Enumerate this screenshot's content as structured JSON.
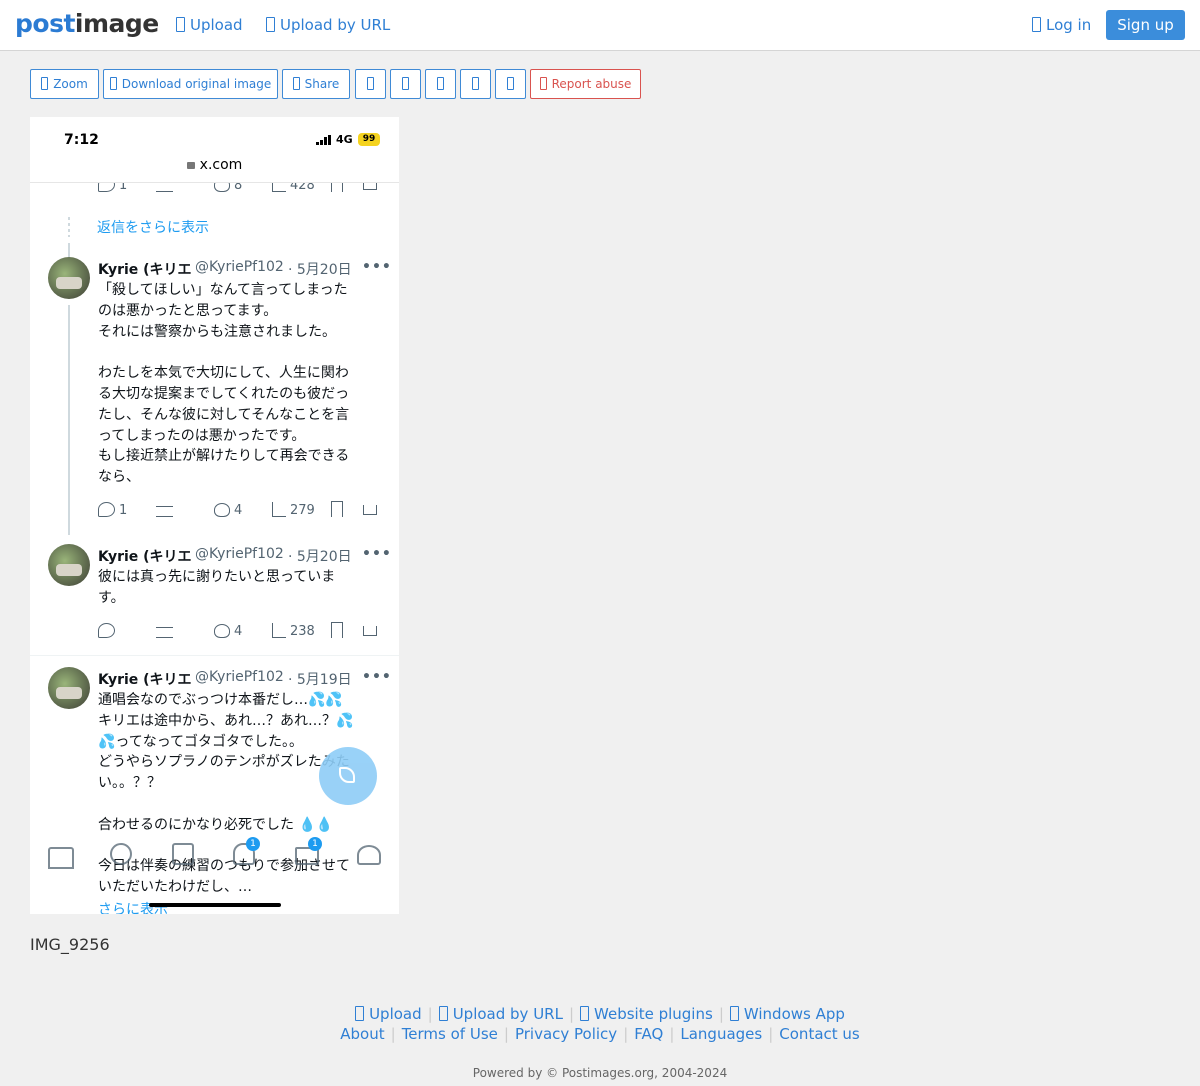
{
  "site": {
    "logo_part1": "post",
    "logo_part2": "image",
    "nav": {
      "upload": "Upload",
      "upload_by_url": "Upload by URL",
      "login": "Log in",
      "signup": "Sign up"
    },
    "accent_color": "#3b8ddb"
  },
  "toolbar": {
    "zoom": "Zoom",
    "download": "Download original image",
    "share": "Share",
    "report": "Report abuse"
  },
  "image": {
    "caption": "IMG_9256",
    "status_bar": {
      "time": "7:12",
      "network": "4G",
      "battery": "99",
      "url": "x.com"
    },
    "top_actions": {
      "replies": "1",
      "likes": "8",
      "views": "428"
    },
    "more_replies_link": "返信をさらに表示",
    "tweets": [
      {
        "name": "Kyrie (キリエ",
        "handle": "@KyriePf102",
        "date": "· 5月20日",
        "lines": [
          "「殺してほしい」なんて言ってしまった",
          "のは悪かったと思ってます。",
          "それには警察からも注意されました。",
          "",
          "わたしを本気で大切にして、人生に関わ",
          "る大切な提案までしてくれたのも彼だっ",
          "たし、そんな彼に対してそんなことを言",
          "ってしまったのは悪かったです。",
          "もし接近禁止が解けたりして再会できる",
          "なら、"
        ],
        "replies": "1",
        "likes": "4",
        "views": "279"
      },
      {
        "name": "Kyrie (キリエ",
        "handle": "@KyriePf102",
        "date": "· 5月20日",
        "lines": [
          "彼には真っ先に謝りたいと思っていま",
          "す。"
        ],
        "replies": "",
        "likes": "4",
        "views": "238"
      },
      {
        "name": "Kyrie (キリエ",
        "handle": "@KyriePf102",
        "date": "· 5月19日",
        "lines": [
          "通唱会なのでぶっつけ本番だし…💦💦",
          "キリエは途中から、あれ…？あれ…？💦",
          "💦ってなってゴタゴタでした。。",
          "どうやらソプラノのテンポがズレたみた",
          "い。。？？",
          "",
          "合わせるのにかなり必死でした 💧💧",
          "",
          "今日は伴奏の練習のつもりで参加させて",
          "いただいたわけだし、…"
        ],
        "show_more": "さらに表示"
      }
    ],
    "tab_badges": {
      "notifications": "1",
      "messages": "1"
    }
  },
  "footer": {
    "row1": [
      "Upload",
      "Upload by URL",
      "Website plugins",
      "Windows App"
    ],
    "row2": [
      "About",
      "Terms of Use",
      "Privacy Policy",
      "FAQ",
      "Languages",
      "Contact us"
    ],
    "powered": "Powered by © Postimages.org, 2004-2024"
  }
}
